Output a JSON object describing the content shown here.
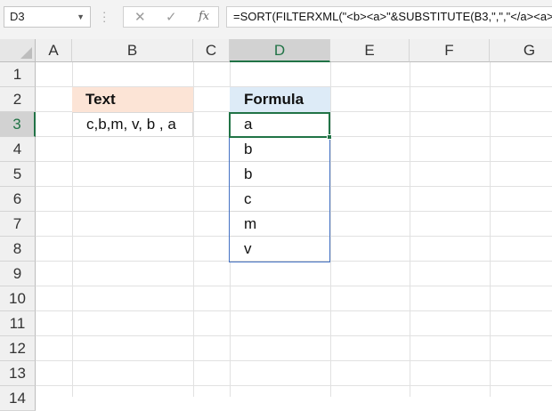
{
  "name_box": {
    "value": "D3"
  },
  "formula_bar": {
    "cancel_glyph": "✕",
    "enter_glyph": "✓",
    "fx_label": "fx",
    "formula": "=SORT(FILTERXML(\"<b><a>\"&SUBSTITUTE(B3,\",\",\"</a><a>\")"
  },
  "columns": [
    "A",
    "B",
    "C",
    "D",
    "E",
    "F",
    "G"
  ],
  "rows": [
    "1",
    "2",
    "3",
    "4",
    "5",
    "6",
    "7",
    "8",
    "9",
    "10",
    "11",
    "12",
    "13",
    "14"
  ],
  "selected_column": "D",
  "selected_row": "3",
  "cells": {
    "B2": "Text",
    "D2": "Formula",
    "B3": "c,b,m, v, b , a",
    "D3": "a",
    "D4": "b",
    "D5": "b",
    "D6": "c",
    "D7": "m",
    "D8": "v"
  },
  "colors": {
    "text_header_fill": "#fce4d6",
    "formula_header_fill": "#ddebf7",
    "selection_green": "#217346",
    "spill_border": "#4472c4"
  }
}
